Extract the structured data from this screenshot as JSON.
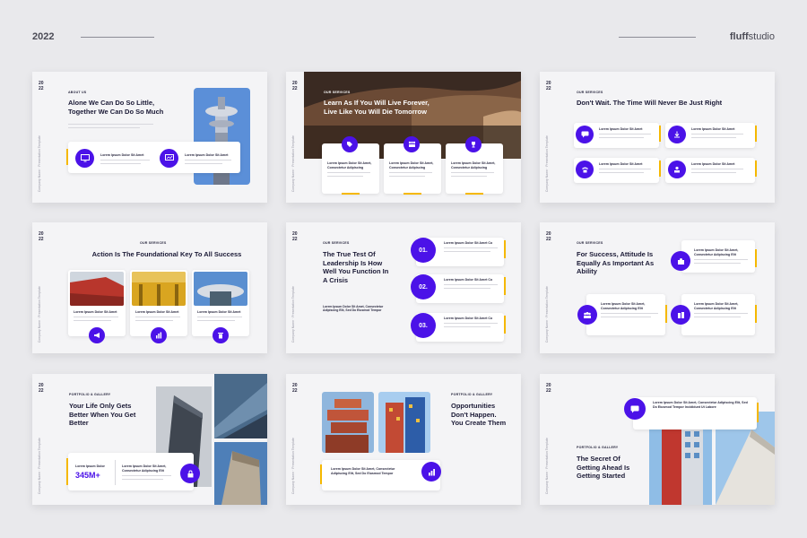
{
  "header": {
    "year": "2022",
    "brand_bold": "fluff",
    "brand_rest": "studio"
  },
  "common": {
    "year_top": "20",
    "year_bottom": "22",
    "side_text": "Company Name · Presentation Template",
    "lorem_title": "Lorem Ipsum Dolor Sit Amet",
    "lorem_title_short": "Lorem Ipsum Dolor Sit Amet",
    "lorem_consectetur": "Lorem Ipsum Dolor Sit Amet, Consectetur Adipiscing",
    "lorem_title_cut": "Lorem Ipsum Dolor Sit Amet Co"
  },
  "slides": {
    "s1": {
      "kicker": "ABOUT US",
      "headline": "Alone We Can Do So Little, Together We Can Do So Much",
      "item1": "Lorem Ipsum Dolor Sit Amet",
      "item2": "Lorem Ipsum Dolor Sit Amet"
    },
    "s2": {
      "kicker": "OUR SERVICES",
      "headline": "Learn As If You Will Live Forever, Live Like You Will Die Tomorrow",
      "card1": "Lorem Ipsum Dolor Sit Amet, Consectetur Adipiscing",
      "card2": "Lorem Ipsum Dolor Sit Amet, Consectetur Adipiscing",
      "card3": "Lorem Ipsum Dolor Sit Amet, Consectetur Adipiscing"
    },
    "s3": {
      "kicker": "OUR SERVICES",
      "headline": "Don't Wait. The Time Will Never Be Just Right",
      "card1": "Lorem Ipsum Dolor Sit Amet",
      "card2": "Lorem Ipsum Dolor Sit Amet",
      "card3": "Lorem Ipsum Dolor Sit Amet",
      "card4": "Lorem Ipsum Dolor Sit Amet"
    },
    "s4": {
      "kicker": "OUR SERVICES",
      "headline": "Action Is The Foundational Key To All Success",
      "card1": "Lorem Ipsum Dolor Sit Amet",
      "card2": "Lorem Ipsum Dolor Sit Amet",
      "card3": "Lorem Ipsum Dolor Sit Amet"
    },
    "s5": {
      "kicker": "OUR SERVICES",
      "headline": "The True Test Of Leadership Is How Well You Function In A Crisis",
      "body": "Lorem Ipsum Dolor Sit Amet, Consectetur Adipiscing Elit, Sed Do Eiusmod Tempor",
      "n1": "01.",
      "n2": "02.",
      "n3": "03.",
      "t1": "Lorem Ipsum Dolor Sit Amet Co",
      "t2": "Lorem Ipsum Dolor Sit Amet Co",
      "t3": "Lorem Ipsum Dolor Sit Amet Co"
    },
    "s6": {
      "kicker": "OUR SERVICES",
      "headline": "For Success, Attitude Is Equally As Important As Ability",
      "c1": "Lorem Ipsum Dolor Sit Amet, Consectetur Adipiscing Elit",
      "c2": "Lorem Ipsum Dolor Sit Amet, Consectetur Adipiscing Elit",
      "c3": "Lorem Ipsum Dolor Sit Amet, Consectetur Adipiscing Elit"
    },
    "s7": {
      "kicker": "PORTFOLIO & GALLERY",
      "headline": "Your Life Only Gets Better When You Get Better",
      "stat_label": "Lorem Ipsum Dolor",
      "stat_value": "345M+",
      "stat_text": "Lorem Ipsum Dolor Sit Amet, Consectetur Adipiscing Elit"
    },
    "s8": {
      "kicker": "PORTFOLIO & GALLERY",
      "headline": "Opportunities Don't Happen. You Create Them",
      "card": "Lorem Ipsum Dolor Sit Amet, Consectetur Adipiscing Elit, Sed Do Eiusmod Tempor"
    },
    "s9": {
      "kicker": "PORTFOLIO & GALLERY",
      "headline": "The Secret Of Getting Ahead Is Getting Started",
      "card": "Lorem Ipsum Dolor Sit Amet, Consectetur Adipiscing Elit, Sed Do Eiusmod Tempor Incididunt Ut Labore"
    }
  },
  "colors": {
    "accent": "#4b12e8",
    "highlight": "#f5b800",
    "background": "#e9e9ec",
    "slide": "#f4f4f6"
  }
}
